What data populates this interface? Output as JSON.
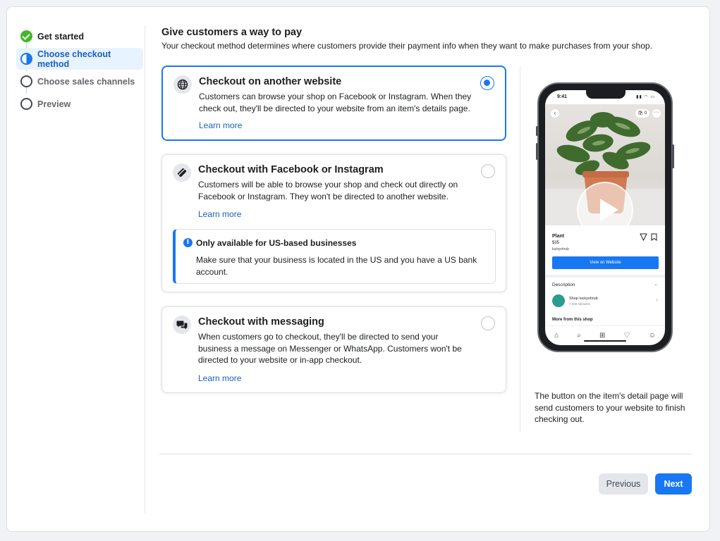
{
  "stepper": {
    "steps": [
      {
        "label": "Get started",
        "state": "done"
      },
      {
        "label": "Choose checkout method",
        "state": "active"
      },
      {
        "label": "Choose sales channels",
        "state": "todo"
      },
      {
        "label": "Preview",
        "state": "todo"
      }
    ]
  },
  "header": {
    "title": "Give customers a way to pay",
    "subtitle": "Your checkout method determines where customers provide their payment info when they want to make purchases from your shop."
  },
  "options": [
    {
      "title": "Checkout on another website",
      "description": "Customers can browse your shop on Facebook or Instagram. When they check out, they'll be directed to your website from an item's details page.",
      "link": "Learn more",
      "selected": true,
      "icon": "globe-icon"
    },
    {
      "title": "Checkout with Facebook or Instagram",
      "description": "Customers will be able to browse your shop and check out directly on Facebook or Instagram. They won't be directed to another website.",
      "link": "Learn more",
      "selected": false,
      "icon": "card-icon",
      "notice": {
        "title": "Only available for US-based businesses",
        "text": "Make sure that your business is located in the US and you have a US bank account."
      }
    },
    {
      "title": "Checkout with messaging",
      "description": "When customers go to checkout, they'll be directed to send your business a message on Messenger or WhatsApp. Customers won't be directed to your website or in-app checkout.",
      "link": "Learn more",
      "selected": false,
      "icon": "chat-bubbles-icon"
    }
  ],
  "preview": {
    "status_time": "9:41",
    "cart_count": "0",
    "product_name": "Plant",
    "product_price": "$35",
    "product_shop": "luckyshrub",
    "view_button": "View on Website",
    "description_label": "Description",
    "shop_name": "Shop luckyshrub",
    "shop_followers": "7,209 followers",
    "more_from_shop": "More from this shop",
    "caption": "The button on the item's detail page will send customers to your website to finish checking out."
  },
  "footer": {
    "previous_label": "Previous",
    "next_label": "Next"
  },
  "colors": {
    "accent": "#1877f2",
    "success": "#42b72a"
  }
}
